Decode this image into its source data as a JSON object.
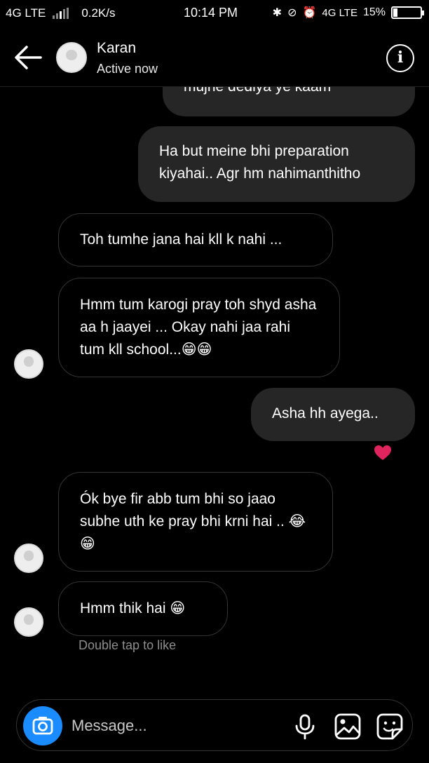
{
  "status_bar": {
    "network": "4G LTE",
    "speed": "0.2K/s",
    "time": "10:14 PM",
    "network2": "4G LTE",
    "battery": "15%",
    "battery_level": 0.15
  },
  "header": {
    "contact_name": "Karan",
    "contact_status": "Active now",
    "back_icon": "arrow-left-icon",
    "info_icon": "info-icon",
    "info_glyph": "i"
  },
  "messages": [
    {
      "direction": "sent",
      "text": "mujhe dediya ye kaam"
    },
    {
      "direction": "sent",
      "text": "Ha but meine bhi preparation kiyahai.. Agr hm nahimanthitho"
    },
    {
      "direction": "received",
      "text": "Toh tumhe jana hai kll k nahi ..."
    },
    {
      "direction": "received",
      "text": "Hmm tum karogi pray toh shyd asha aa h jaayei ... Okay nahi jaa rahi tum kll school...😁😁"
    },
    {
      "direction": "sent",
      "text": "Asha hh ayega..",
      "reaction": "heart"
    },
    {
      "direction": "received",
      "text": "Ók bye fir abb tum bhi so jaao subhe uth ke pray bhi krni hai .. 😂😁"
    },
    {
      "direction": "received",
      "text": "Hmm thik hai 😁"
    }
  ],
  "hint": "Double tap to like",
  "composer": {
    "placeholder": "Message...",
    "icons": [
      "camera-icon",
      "microphone-icon",
      "gallery-icon",
      "sticker-icon"
    ]
  },
  "colors": {
    "background": "#000000",
    "sent_bubble": "#262626",
    "received_border": "#333333",
    "camera_button": "#1a8cff",
    "heart": "#e0245e"
  }
}
